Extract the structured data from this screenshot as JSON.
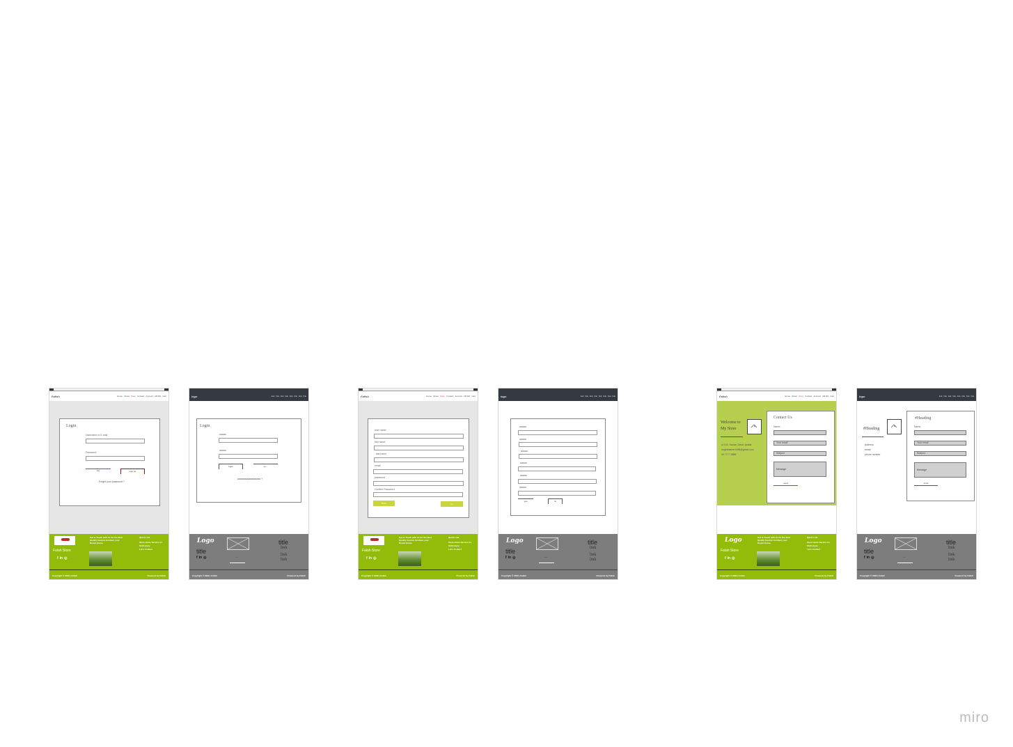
{
  "brand": {
    "watermark": "miro"
  },
  "nav_light": {
    "logo": "Fafish",
    "links": [
      "Home",
      "About",
      "Shop",
      "Contact",
      "Account",
      "AR EN",
      "Cart"
    ],
    "active": "Shop"
  },
  "nav_dark": {
    "logo": "logo",
    "links": [
      "link",
      "link",
      "link",
      "link",
      "link",
      "link",
      "link",
      "link"
    ]
  },
  "login": {
    "title": "Login",
    "user_label": "Username or E-mail",
    "pass_label": "Password",
    "btn_left": "log",
    "btn_right": "sign up",
    "forgot": "Forget your password ?"
  },
  "login_wire": {
    "title": "Login",
    "label1": "aaaaa",
    "label2": "aaaaa",
    "btn_left": "login",
    "btn_right": "yo...",
    "forgot": "aaaaaaaaaaaaaaaaa ?"
  },
  "signup": {
    "labels": [
      "user name",
      "first name",
      "last name",
      "email",
      "password",
      "Confirm Password"
    ],
    "btn_left": "Back",
    "btn_right": "up"
  },
  "signup_wire": {
    "labels": [
      "aaaaa",
      "aaaaa",
      "aaaaa",
      "aaaaa",
      "aaaaa",
      "aaaaa"
    ],
    "btn_left": "yes",
    "btn_right": "no"
  },
  "footer_green": {
    "store": "Falah Store",
    "tagline": "Get in Touch with Us for the Best Quality Custom furniture your Dream Home.",
    "quick_title": "Quick Link",
    "quick_links": [
      "Store Home Service Co",
      "Shift Home",
      "Let's Contact"
    ],
    "copyright": "Copyright © 2022 | Fafish",
    "powered": "Powered by Fafish",
    "socials": [
      "f",
      "in",
      "◎"
    ],
    "logo_text": "Logo"
  },
  "footer_wire": {
    "logo_text": "Logo",
    "title": "title",
    "title2": "title",
    "links": [
      "link",
      "link",
      "link"
    ],
    "caption": "—",
    "copyright": "Copyright © 2022 | Fafish",
    "powered": "Powered by Fafish",
    "socials": [
      "f",
      "in",
      "◎"
    ]
  },
  "contact": {
    "welcome": "Welcome to My Store",
    "address": "st 100, Sanaa, Jabal, jandar",
    "email": "majeedamer1998@gmail.com",
    "phone": "00 7777 8888",
    "title": "Contact Us",
    "name_label": "Name:",
    "email_ph": "Your email",
    "subject_ph": "Subject",
    "message_ph": "Message",
    "send": "send"
  },
  "contact_wire": {
    "heading_left": "#Heading",
    "heading_right": "#Heading",
    "address": "Address",
    "email": "email",
    "phone": "phone number",
    "name_label": "Name:",
    "email_ph": "Your email",
    "subject_ph": "Subject",
    "message_ph": "Message",
    "send": "send"
  }
}
